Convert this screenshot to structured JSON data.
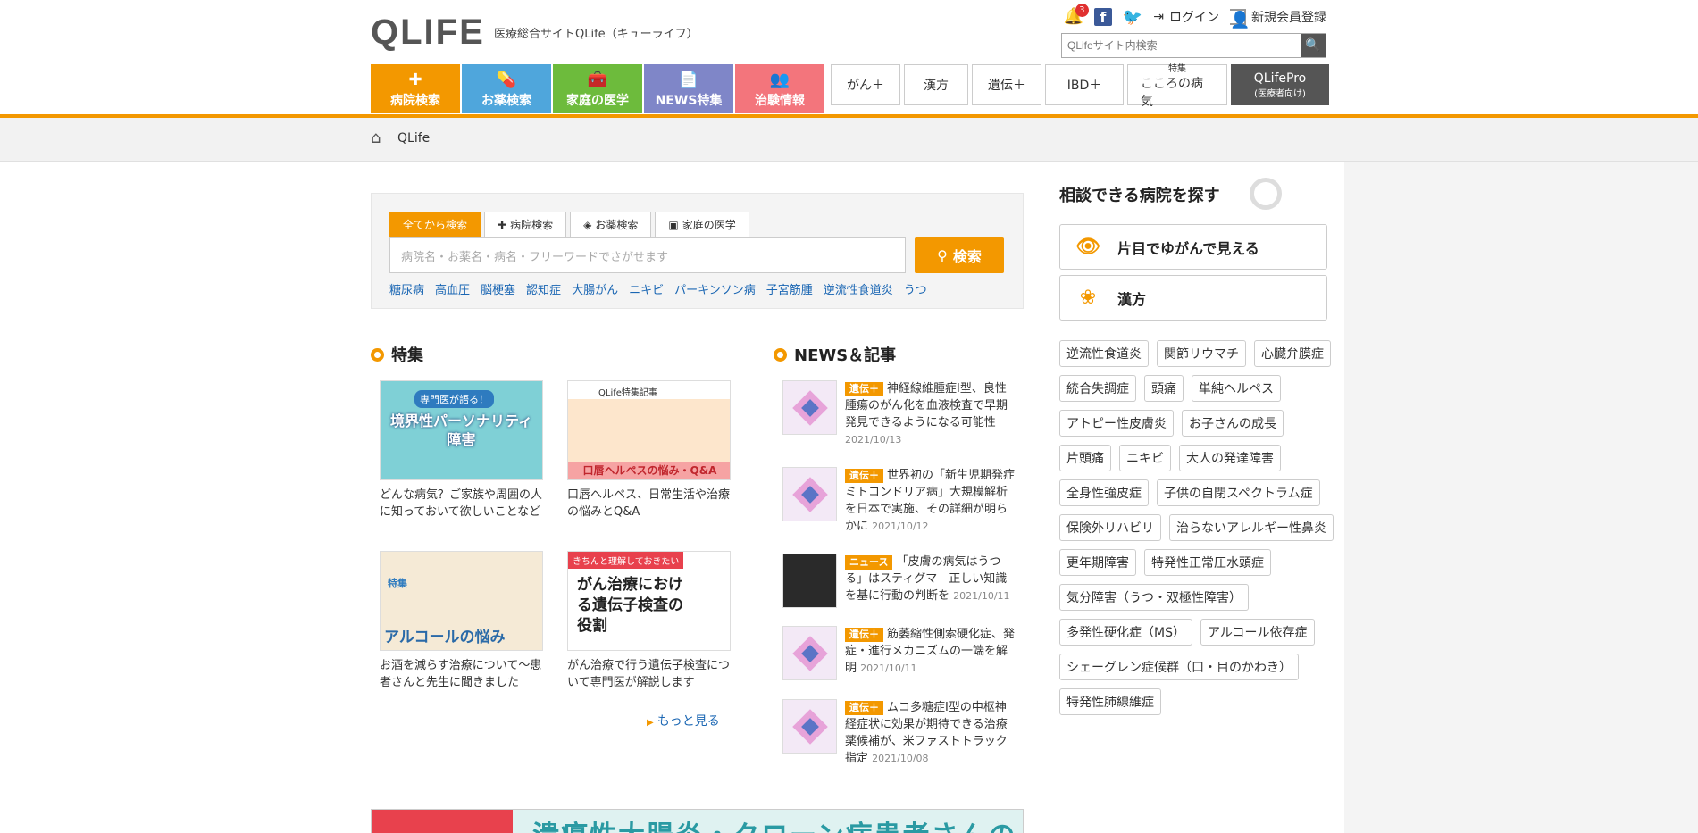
{
  "header": {
    "logo_text": "QLIFE",
    "tagline": "医療総合サイトQLife（キューライフ）",
    "notification_count": "3",
    "login_label": "ログイン",
    "register_label": "新規会員登録",
    "site_search_placeholder": "QLifeサイト内検索"
  },
  "nav": {
    "categories": [
      {
        "label": "病院検索",
        "icon": "hospital-icon",
        "color": "#f39800"
      },
      {
        "label": "お薬検索",
        "icon": "pill-icon",
        "color": "#4fa6dc"
      },
      {
        "label": "家庭の医学",
        "icon": "medkit-icon",
        "color": "#6dbb3c"
      },
      {
        "label": "NEWS特集",
        "icon": "document-icon",
        "color": "#7f86c8"
      },
      {
        "label": "治験情報",
        "icon": "people-icon",
        "color": "#f3757c"
      }
    ],
    "sub_items": [
      {
        "label": "がん＋"
      },
      {
        "label": "漢方"
      },
      {
        "label": "遺伝＋"
      },
      {
        "label": "IBD＋"
      },
      {
        "small": "特集",
        "label": "こころの病気"
      },
      {
        "label": "QLifePro",
        "small2": "(医療者向け)"
      }
    ]
  },
  "breadcrumb": {
    "home": "QLife"
  },
  "search": {
    "tabs": [
      "全てから検索",
      "病院検索",
      "お薬検索",
      "家庭の医学"
    ],
    "placeholder": "病院名・お薬名・病名・フリーワードでさがせます",
    "button_label": "検索",
    "keywords": [
      "糖尿病",
      "高血圧",
      "脳梗塞",
      "認知症",
      "大腸がん",
      "ニキビ",
      "パーキンソン病",
      "子宮筋腫",
      "逆流性食道炎",
      "うつ"
    ]
  },
  "features": {
    "title": "特集",
    "cards": [
      {
        "caption": "どんな病気？ご家族や周囲の人に知っておいて欲しいことなど",
        "img_title": "境界性パーソナリティ障害",
        "img_badge": "専門医が語る！"
      },
      {
        "caption": "口唇ヘルペス、日常生活や治療の悩みとQ&A",
        "img_title": "口唇ヘルペスの悩み・Q&A",
        "img_badge": "QLife特集記事"
      },
      {
        "caption": "お酒を減らす治療について～患者さんと先生に聞きました",
        "img_title": "アルコールの悩み",
        "img_badge": "特集"
      },
      {
        "caption": "がん治療で行う遺伝子検査について専門医が解説します",
        "img_title": "がん治療における遺伝子検査の役割",
        "img_badge": "きちんと理解しておきたい"
      }
    ],
    "more_label": "もっと見る"
  },
  "news": {
    "title": "NEWS＆記事",
    "items": [
      {
        "tag": "遺伝＋",
        "text": "神経線維腫症I型、良性腫瘍のがん化を血液検査で早期発見できるようになる可能性",
        "date": "2021/10/13"
      },
      {
        "tag": "遺伝＋",
        "text": "世界初の「新生児期発症ミトコンドリア病」大規模解析を日本で実施、その詳細が明らかに",
        "date": "2021/10/12"
      },
      {
        "tag": "ニュース",
        "text": "「皮膚の病気はうつる」はスティグマ　正しい知識を基に行動の判断を",
        "date": "2021/10/11"
      },
      {
        "tag": "遺伝＋",
        "text": "筋萎縮性側索硬化症、発症・進行メカニズムの一端を解明",
        "date": "2021/10/11"
      },
      {
        "tag": "遺伝＋",
        "text": "ムコ多糖症I型の中枢神経症状に効果が期待できる治療薬候補が、米ファストトラック指定",
        "date": "2021/10/08"
      }
    ]
  },
  "banner": {
    "text": "潰瘍性大腸炎・クローン病患者さんの"
  },
  "sidebar": {
    "title": "相談できる病院を探す",
    "big_buttons": [
      {
        "label": "片目でゆがんで見える",
        "icon": "eye-icon"
      },
      {
        "label": "漢方",
        "icon": "herb-icon"
      }
    ],
    "chips": [
      "逆流性食道炎",
      "関節リウマチ",
      "心臓弁膜症",
      "統合失調症",
      "頭痛",
      "単純ヘルペス",
      "アトピー性皮膚炎",
      "お子さんの成長",
      "片頭痛",
      "ニキビ",
      "大人の発達障害",
      "全身性強皮症",
      "子供の自閉スペクトラム症",
      "保険外リハビリ",
      "治らないアレルギー性鼻炎",
      "更年期障害",
      "特発性正常圧水頭症",
      "気分障害（うつ・双極性障害）",
      "多発性硬化症（MS）",
      "アルコール依存症",
      "シェーグレン症候群（口・目のかわき）",
      "特発性肺線維症"
    ]
  }
}
